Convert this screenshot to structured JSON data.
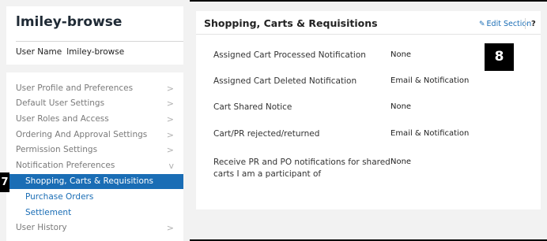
{
  "user": {
    "title": "lmiley-browse",
    "name_label": "User Name",
    "name_value": "lmiley-browse"
  },
  "sidebar": {
    "items": [
      {
        "label": "User Profile and Preferences",
        "chevron": ">"
      },
      {
        "label": "Default User Settings",
        "chevron": ">"
      },
      {
        "label": "User Roles and Access",
        "chevron": ">"
      },
      {
        "label": "Ordering And Approval Settings",
        "chevron": ">"
      },
      {
        "label": "Permission Settings",
        "chevron": ">"
      },
      {
        "label": "Notification Preferences",
        "chevron": "v"
      },
      {
        "label": "Shopping, Carts & Requisitions"
      },
      {
        "label": "Purchase Orders"
      },
      {
        "label": "Settlement"
      },
      {
        "label": "User History",
        "chevron": ">"
      }
    ]
  },
  "badges": {
    "left": "7",
    "right": "8"
  },
  "panel": {
    "title": "Shopping, Carts & Requisitions",
    "edit_label": "Edit Section",
    "help_label": "?",
    "rows": [
      {
        "label": "Assigned Cart Processed Notification",
        "value": "None"
      },
      {
        "label": "Assigned Cart Deleted Notification",
        "value": "Email & Notification"
      },
      {
        "label": "Cart Shared Notice",
        "value": "None"
      },
      {
        "label": "Cart/PR rejected/returned",
        "value": "Email & Notification"
      },
      {
        "label": "Receive PR and PO notifications for shared carts I am a participant of",
        "value": "None"
      }
    ]
  },
  "colors": {
    "accent": "#1a6db5",
    "background": "#f2f2f2"
  }
}
